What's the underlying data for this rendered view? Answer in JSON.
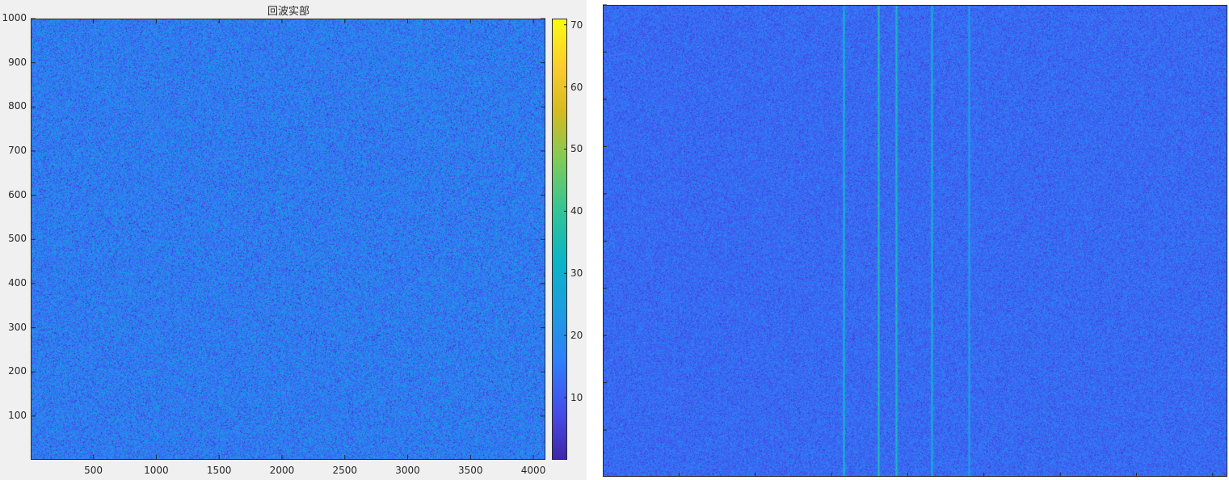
{
  "chart_data": [
    {
      "type": "heatmap",
      "title": "回波实部",
      "x_ticks": [
        500,
        1000,
        1500,
        2000,
        2500,
        3000,
        3500,
        4000
      ],
      "y_ticks": [
        100,
        200,
        300,
        400,
        500,
        600,
        700,
        800,
        900,
        1000
      ],
      "xlim": [
        1,
        4096
      ],
      "ylim": [
        1,
        1000
      ],
      "colorbar": {
        "ticks": [
          10,
          20,
          30,
          40,
          50,
          60,
          70
        ],
        "range": [
          0,
          71
        ],
        "colormap": "parula"
      },
      "value_distribution": {
        "typical_min": 5,
        "typical_max": 28,
        "mean": 16
      }
    },
    {
      "type": "heatmap",
      "title": "",
      "background_value_range": [
        5,
        20
      ],
      "vertical_lines": [
        {
          "position": 0.385,
          "value": 33
        },
        {
          "position": 0.441,
          "value": 36
        },
        {
          "position": 0.469,
          "value": 34
        },
        {
          "position": 0.527,
          "value": 31
        },
        {
          "position": 0.586,
          "value": 26
        }
      ]
    }
  ]
}
